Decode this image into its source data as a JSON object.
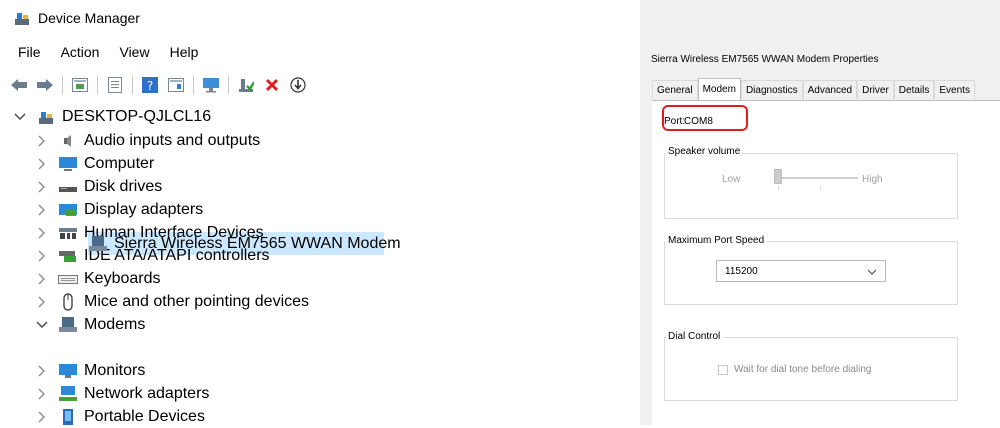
{
  "device_manager": {
    "title": "Device Manager",
    "menu": [
      "File",
      "Action",
      "View",
      "Help"
    ],
    "toolbar_icons": [
      "back-icon",
      "forward-icon",
      "tree-view-icon",
      "properties-icon",
      "help-icon",
      "devices-view-icon",
      "monitor-scan-icon",
      "enable-device-icon",
      "uninstall-icon",
      "update-driver-icon"
    ],
    "root": "DESKTOP-QJLCL16",
    "categories": [
      {
        "label": "Audio inputs and outputs",
        "icon": "speaker-icon",
        "expanded": false
      },
      {
        "label": "Computer",
        "icon": "computer-icon",
        "expanded": false
      },
      {
        "label": "Disk drives",
        "icon": "disk-drive-icon",
        "expanded": false
      },
      {
        "label": "Display adapters",
        "icon": "display-adapter-icon",
        "expanded": false
      },
      {
        "label": "Human Interface Devices",
        "icon": "hid-icon",
        "expanded": false
      },
      {
        "label": "IDE ATA/ATAPI controllers",
        "icon": "ide-controller-icon",
        "expanded": false
      },
      {
        "label": "Keyboards",
        "icon": "keyboard-icon",
        "expanded": false
      },
      {
        "label": "Mice and other pointing devices",
        "icon": "mouse-icon",
        "expanded": false
      },
      {
        "label": "Modems",
        "icon": "modem-icon",
        "expanded": true
      },
      {
        "label": "Monitors",
        "icon": "monitor-icon",
        "expanded": false
      },
      {
        "label": "Network adapters",
        "icon": "network-adapter-icon",
        "expanded": false
      },
      {
        "label": "Portable Devices",
        "icon": "portable-device-icon",
        "expanded": false
      }
    ],
    "selected_device": "Sierra Wireless EM7565 WWAN Modem"
  },
  "properties": {
    "title": "Sierra Wireless EM7565 WWAN Modem Properties",
    "tabs": [
      "General",
      "Modem",
      "Diagnostics",
      "Advanced",
      "Driver",
      "Details",
      "Events"
    ],
    "active_tab": "Modem",
    "port_label": "Port:",
    "port_value": "COM8",
    "speaker_volume": {
      "title": "Speaker volume",
      "low": "Low",
      "high": "High",
      "level": 0
    },
    "max_port_speed": {
      "title": "Maximum Port Speed",
      "value": "115200"
    },
    "dial_control": {
      "title": "Dial Control",
      "checkbox_label": "Wait for dial tone before dialing",
      "checked": false
    },
    "highlight_color": "#e11d1d",
    "selection_color": "#cce8ff"
  }
}
